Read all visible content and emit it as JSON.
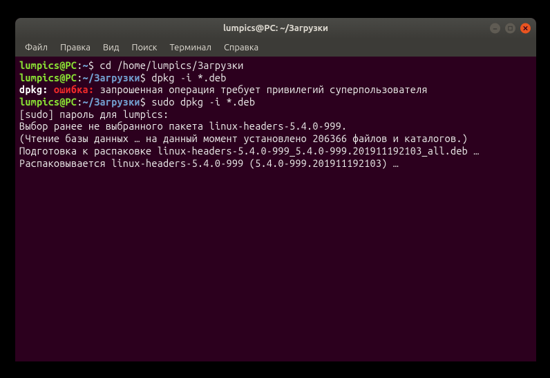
{
  "window": {
    "title": "lumpics@PC: ~/Загрузки"
  },
  "menubar": {
    "items": [
      {
        "label": "Файл"
      },
      {
        "label": "Правка"
      },
      {
        "label": "Вид"
      },
      {
        "label": "Поиск"
      },
      {
        "label": "Терминал"
      },
      {
        "label": "Справка"
      }
    ]
  },
  "terminal": {
    "prompt1_user": "lumpics@PC",
    "prompt1_sep": ":",
    "prompt1_path": "~",
    "prompt1_end": "$ ",
    "cmd1": "cd /home/lumpics/Загрузки",
    "prompt2_user": "lumpics@PC",
    "prompt2_sep": ":",
    "prompt2_path": "~/Загрузки",
    "prompt2_end": "$ ",
    "cmd2": "dpkg -i *.deb",
    "err_prefix": "dpkg: ",
    "err_word": "ошибка: ",
    "err_text": "запрошенная операция требует привилегий суперпользователя",
    "prompt3_user": "lumpics@PC",
    "prompt3_sep": ":",
    "prompt3_path": "~/Загрузки",
    "prompt3_end": "$ ",
    "cmd3": "sudo dpkg -i *.deb",
    "sudo_line": "[sudo] пароль для lumpics: ",
    "out1": "Выбор ранее не выбранного пакета linux-headers-5.4.0-999.",
    "out2": "(Чтение базы данных … на данный момент установлено 206366 файлов и каталогов.)",
    "out3": "Подготовка к распаковке linux-headers-5.4.0-999_5.4.0-999.201911192103_all.deb …",
    "out4": "Распаковывается linux-headers-5.4.0-999 (5.4.0-999.201911192103) …"
  }
}
